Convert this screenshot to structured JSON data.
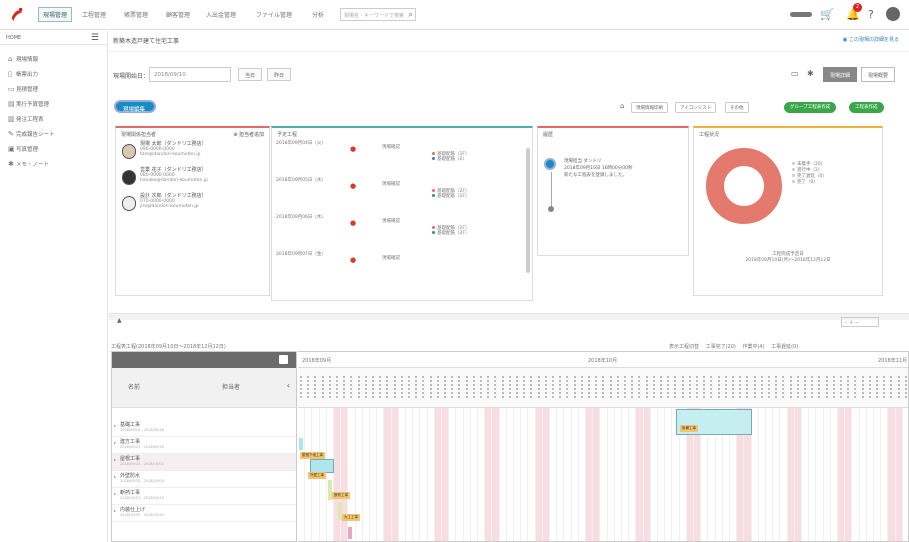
{
  "topnav": {
    "tabs": [
      "現場管理",
      "工程管理",
      "帳票管理",
      "顧客管理",
      "入出金管理",
      "ファイル管理",
      "分析"
    ],
    "search_placeholder": "現場名・キーワードで検索",
    "icons": [
      "cart-icon",
      "bell-icon",
      "help-icon",
      "user-icon"
    ],
    "notification_count": "2"
  },
  "sidebar": {
    "header": "HOME",
    "items": [
      "現場情報",
      "帳票出力",
      "見積管理",
      "実行予算管理",
      "発注工程表",
      "完成報告シート",
      "写真管理",
      "メモ・ノート"
    ]
  },
  "page": {
    "title": "新築木造戸建て住宅工事",
    "title_link": "この現場の詳細を見る",
    "date_label": "現場開始日：",
    "date_value": "2018/09/10",
    "btn_today": "当日",
    "btn_prev": "昨日",
    "view_toggle": [
      "現場詳細",
      "現場概要"
    ]
  },
  "actions": {
    "pill": "現場編集する",
    "buttons": [
      "現場情報印刷",
      "アイコンリスト",
      "その他"
    ],
    "green_buttons": [
      "グループ工程表作成",
      "工程表作成"
    ]
  },
  "panels": {
    "contacts": {
      "title": "現場関係担当者",
      "link": "担当者追加",
      "people": [
        {
          "name": "現場 太郎（ダンドリ工務店）",
          "tel": "090-0000-0000",
          "mail": "taro@dandori-koumuten.jp"
        },
        {
          "name": "営業 花子（ダンドリ工務店）",
          "tel": "080-0000-0000",
          "mail": "hanako@dandori-koumuten.jp"
        },
        {
          "name": "設計 次郎（ダンドリ工務店）",
          "tel": "070-0000-0000",
          "mail": "jiro@dandori-koumuten.jp"
        }
      ]
    },
    "schedule": {
      "title": "予定工程",
      "rows": [
        {
          "date": "2018年09月04日（火）",
          "type": "現場確認",
          "tags": [
            "基礎配筋（1F）",
            "基礎配筋（2）"
          ]
        },
        {
          "date": "2018年09月05日（水）",
          "type": "現場確認",
          "tags": [
            "基礎配筋（2F）",
            "基礎配筋（1F）"
          ]
        },
        {
          "date": "2018年09月06日（木）",
          "type": "現場確認",
          "tags": [
            "基礎配筋（1F）",
            "基礎配筋（2F）"
          ]
        },
        {
          "date": "2018年09月07日（金）",
          "type": "現場確認",
          "tags": []
        }
      ]
    },
    "history": {
      "title": "履歴",
      "name": "現場担当 ダンドリ",
      "line1": "2018年09月10日 16時00分00秒",
      "line2": "新たな工程表を登録しました。"
    },
    "progress": {
      "title": "工程状況",
      "legend": [
        "未着手（20）",
        "進行中（2）",
        "完了遅延（0）",
        "完了（0）"
      ],
      "caption1": "工程完成予定日",
      "caption2": "2018年09月10日(月)〜2018年12月12日"
    }
  },
  "gantt": {
    "header": "工程表工程(2018年09月10日〜2018年12月12日)",
    "legend": [
      "表示工程切替",
      "工事完了(20)",
      "作業中(4)",
      "工事遅延(0)",
      "完工(0)"
    ],
    "col_name": "名前",
    "col_status": "担当者",
    "months": [
      "2018年09月",
      "2018年10月",
      "2018年11月"
    ],
    "rows": [
      {
        "name": "基礎工事",
        "sub": "2018/09/10 - 2018/09/18"
      },
      {
        "name": "建方工事",
        "sub": "2018/09/19 - 2018/09/30"
      },
      {
        "name": "屋根工事",
        "sub": "2018/09/20 - 2018/10/02"
      },
      {
        "name": "外壁防水",
        "sub": "2018/09/25 - 2018/10/05"
      },
      {
        "name": "断熱工事",
        "sub": "2018/10/01 - 2018/10/10"
      },
      {
        "name": "内装仕上げ",
        "sub": "2018/10/05 - 2018/10/20"
      }
    ],
    "bar_labels": [
      "屋根下地工事",
      "外壁工事",
      "断熱工事",
      "大工工事",
      "設備工事"
    ]
  },
  "colors": {
    "accent_blue": "#1a8cc4",
    "green": "#3aa64a",
    "red_pin": "#d93a2a",
    "donut": "#e47a6d",
    "weekend": "#f8dde2"
  }
}
